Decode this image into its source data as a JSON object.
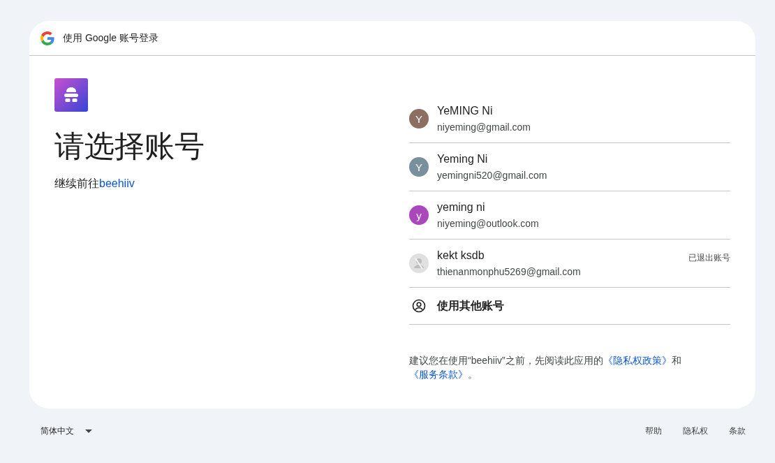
{
  "header": {
    "title": "使用 Google 账号登录"
  },
  "heading": "请选择账号",
  "continue": {
    "text": "继续前往",
    "app_link": "beehiiv"
  },
  "accounts": [
    {
      "name": "YeMING Ni",
      "email": "niyeming@gmail.com",
      "avatar": {
        "kind": "letter",
        "letter": "Y",
        "color": "#8d6e63"
      }
    },
    {
      "name": "Yeming Ni",
      "email": "yemingni520@gmail.com",
      "avatar": {
        "kind": "letter",
        "letter": "Y",
        "color": "#78909c"
      }
    },
    {
      "name": "yeming ni",
      "email": "niyeming@outlook.com",
      "avatar": {
        "kind": "letter",
        "letter": "y",
        "color": "#ab47bc"
      }
    },
    {
      "name": "kekt ksdb",
      "email": "thienanmonphu5269@gmail.com",
      "avatar": {
        "kind": "signed_out"
      },
      "status": "已退出账号"
    }
  ],
  "other_account": {
    "label": "使用其他账号"
  },
  "consent": {
    "before": "建议您在使用“beehiiv”之前，先阅读此应用的",
    "privacy_link": "《隐私权政策》",
    "middle": "和",
    "terms_link": "《服务条款》",
    "after": "。"
  },
  "footer": {
    "language": "简体中文",
    "links": [
      "帮助",
      "隐私权",
      "条款"
    ]
  }
}
